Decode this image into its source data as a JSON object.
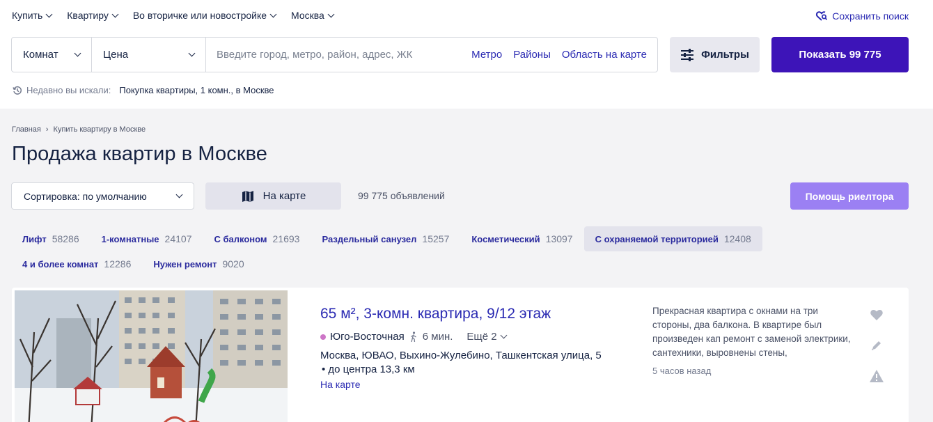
{
  "topnav": {
    "items": [
      {
        "label": "Купить"
      },
      {
        "label": "Квартиру"
      },
      {
        "label": "Во вторичке или новостройке"
      },
      {
        "label": "Москва"
      }
    ],
    "save_search": "Сохранить поиск"
  },
  "search": {
    "rooms": "Комнат",
    "price": "Цена",
    "placeholder": "Введите город, метро, район, адрес, ЖК",
    "links": [
      "Метро",
      "Районы",
      "Область на карте"
    ],
    "filters_label": "Фильтры",
    "show_label": "Показать 99 775"
  },
  "recent": {
    "label": "Недавно вы искали:",
    "value": "Покупка квартиры, 1 комн., в Москве"
  },
  "breadcrumbs": [
    "Главная",
    "Купить квартиру в Москве"
  ],
  "page_title": "Продажа квартир в Москве",
  "toolbar": {
    "sort_label": "Сортировка: по умолчанию",
    "map_label": "На карте",
    "count": "99 775 объявлений",
    "realtor_label": "Помощь риелтора"
  },
  "tags": [
    {
      "name": "Лифт",
      "count": "58286",
      "active": false
    },
    {
      "name": "1-комнатные",
      "count": "24107",
      "active": false
    },
    {
      "name": "С балконом",
      "count": "21693",
      "active": false
    },
    {
      "name": "Раздельный санузел",
      "count": "15257",
      "active": false
    },
    {
      "name": "Косметический",
      "count": "13097",
      "active": false
    },
    {
      "name": "С охраняемой территорией",
      "count": "12408",
      "active": true
    },
    {
      "name": "4 и более комнат",
      "count": "12286",
      "active": false
    },
    {
      "name": "Нужен ремонт",
      "count": "9020",
      "active": false
    }
  ],
  "listing": {
    "title": "65 м², 3-комн. квартира, 9/12 этаж",
    "metro": "Юго-Восточная",
    "metro_color": "#cd76c7",
    "walk": "6 мин.",
    "more": "Ещё 2",
    "address": "Москва, ЮВАО, Выхино-Жулебино, Ташкентская улица, 5",
    "distance": "• до центра 13,3 км",
    "map_link": "На карте",
    "description": "Прекрасная квартира с окнами на три стороны, два балкона. В квартире был произведен кап ремонт с заменой электрики, сантехники, выровнены стены,",
    "time": "5 часов назад"
  },
  "colors": {
    "brand": "#3d14b8",
    "link": "#2b2bb3",
    "realtor": "#9b80f3"
  }
}
